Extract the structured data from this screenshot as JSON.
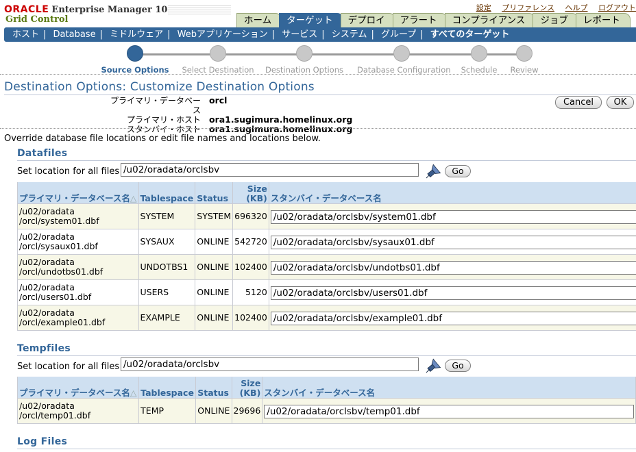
{
  "header": {
    "brand": "ORACLE",
    "product": "Enterprise Manager 10g",
    "product_sub": "Grid Control",
    "global_links": [
      "設定",
      "プリファレンス",
      "ヘルプ",
      "ログアウト"
    ],
    "tabs": [
      "ホーム",
      "ターゲット",
      "デプロイ",
      "アラート",
      "コンプライアンス",
      "ジョブ",
      "レポート"
    ],
    "active_tab": "ターゲット"
  },
  "subnav": {
    "items": [
      "ホスト",
      "Database",
      "ミドルウェア",
      "Webアプリケーション",
      "サービス",
      "システム",
      "グループ",
      "すべてのターゲット"
    ],
    "current": "すべてのターゲット"
  },
  "train": {
    "steps": [
      "Source Options",
      "Select Destination",
      "Destination Options",
      "Database Configuration",
      "Schedule",
      "Review"
    ],
    "active": "Source Options"
  },
  "page": {
    "title": "Destination Options: Customize Destination Options",
    "info": [
      {
        "label": "プライマリ・データベース",
        "value": "orcl"
      },
      {
        "label": "プライマリ・ホスト",
        "value": "ora1.sugimura.homelinux.org"
      },
      {
        "label": "スタンバイ・ホスト",
        "value": "ora1.sugimura.homelinux.org"
      }
    ],
    "cancel_label": "Cancel",
    "ok_label": "OK",
    "instructions": "Override database file locations or edit file names and locations below."
  },
  "datafiles": {
    "heading": "Datafiles",
    "set_location_label": "Set location for all files",
    "set_location_value": "/u02/oradata/orclsbv",
    "go_label": "Go",
    "columns": [
      "プライマリ・データベース名",
      "Tablespace",
      "Status",
      "Size (KB)",
      "スタンバイ・データベース名"
    ],
    "size_col_top": "Size",
    "size_col_bottom": "(KB)",
    "rows": [
      {
        "primary1": "/u02/oradata",
        "primary2": "/orcl/system01.dbf",
        "tablespace": "SYSTEM",
        "status": "SYSTEM",
        "size": "696320",
        "standby": "/u02/oradata/orclsbv/system01.dbf"
      },
      {
        "primary1": "/u02/oradata",
        "primary2": "/orcl/sysaux01.dbf",
        "tablespace": "SYSAUX",
        "status": "ONLINE",
        "size": "542720",
        "standby": "/u02/oradata/orclsbv/sysaux01.dbf"
      },
      {
        "primary1": "/u02/oradata",
        "primary2": "/orcl/undotbs01.dbf",
        "tablespace": "UNDOTBS1",
        "status": "ONLINE",
        "size": "102400",
        "standby": "/u02/oradata/orclsbv/undotbs01.dbf"
      },
      {
        "primary1": "/u02/oradata",
        "primary2": "/orcl/users01.dbf",
        "tablespace": "USERS",
        "status": "ONLINE",
        "size": "5120",
        "standby": "/u02/oradata/orclsbv/users01.dbf"
      },
      {
        "primary1": "/u02/oradata",
        "primary2": "/orcl/example01.dbf",
        "tablespace": "EXAMPLE",
        "status": "ONLINE",
        "size": "102400",
        "standby": "/u02/oradata/orclsbv/example01.dbf"
      }
    ]
  },
  "tempfiles": {
    "heading": "Tempfiles",
    "set_location_label": "Set location for all files",
    "set_location_value": "/u02/oradata/orclsbv",
    "go_label": "Go",
    "columns": [
      "プライマリ・データベース名",
      "Tablespace",
      "Status",
      "Size (KB)",
      "スタンバイ・データベース名"
    ],
    "size_col_top": "Size",
    "size_col_bottom": "(KB)",
    "rows": [
      {
        "primary1": "/u02/oradata",
        "primary2": "/orcl/temp01.dbf",
        "tablespace": "TEMP",
        "status": "ONLINE",
        "size": "29696",
        "standby": "/u02/oradata/orclsbv/temp01.dbf"
      }
    ]
  },
  "logfiles": {
    "heading": "Log Files"
  }
}
